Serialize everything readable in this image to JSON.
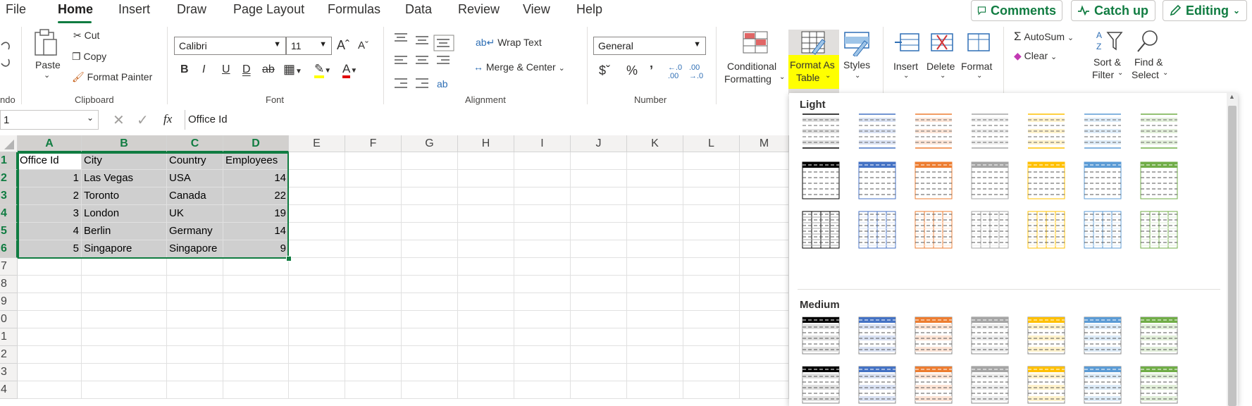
{
  "tabs": {
    "file": "File",
    "home": "Home",
    "insert": "Insert",
    "draw": "Draw",
    "page_layout": "Page Layout",
    "formulas": "Formulas",
    "data": "Data",
    "review": "Review",
    "view": "View",
    "help": "Help"
  },
  "top_buttons": {
    "comments": "Comments",
    "catch_up": "Catch up",
    "editing": "Editing"
  },
  "ribbon": {
    "undo_group_label": "ndo",
    "clipboard": {
      "paste": "Paste",
      "cut": "Cut",
      "copy": "Copy",
      "format_painter": "Format Painter",
      "label": "Clipboard"
    },
    "font": {
      "font_name": "Calibri",
      "font_size": "11",
      "label": "Font"
    },
    "alignment": {
      "wrap_text": "Wrap Text",
      "merge_center": "Merge & Center",
      "label": "Alignment"
    },
    "number": {
      "format": "General",
      "label": "Number"
    },
    "styles": {
      "conditional_formatting_1": "Conditional",
      "conditional_formatting_2": "Formatting",
      "format_as_table_1": "Format As",
      "format_as_table_2": "Table",
      "styles": "Styles"
    },
    "cells": {
      "insert": "Insert",
      "delete": "Delete",
      "format": "Format"
    },
    "editing": {
      "autosum": "AutoSum",
      "clear": "Clear",
      "sort_filter_1": "Sort &",
      "sort_filter_2": "Filter",
      "find_select_1": "Find &",
      "find_select_2": "Select"
    }
  },
  "formula_bar": {
    "name_box": "1",
    "fx": "fx",
    "content": "Office Id"
  },
  "columns": [
    "A",
    "B",
    "C",
    "D",
    "E",
    "F",
    "G",
    "H",
    "I",
    "J",
    "K",
    "L",
    "M"
  ],
  "rows": [
    "1",
    "2",
    "3",
    "4",
    "5",
    "6",
    "7",
    "8",
    "9",
    "0",
    "1",
    "2",
    "3",
    "4"
  ],
  "sheet": {
    "headers": [
      "Office Id",
      "City",
      "Country",
      "Employees"
    ],
    "data": [
      [
        "1",
        "Las Vegas",
        "USA",
        "14"
      ],
      [
        "2",
        "Toronto",
        "Canada",
        "22"
      ],
      [
        "3",
        "London",
        "UK",
        "19"
      ],
      [
        "4",
        "Berlin",
        "Germany",
        "14"
      ],
      [
        "5",
        "Singapore",
        "Singapore",
        "9"
      ]
    ]
  },
  "gallery": {
    "light_label": "Light",
    "medium_label": "Medium",
    "colors": [
      "#000000",
      "#4472c4",
      "#ed7d31",
      "#a5a5a5",
      "#ffc000",
      "#5b9bd5",
      "#70ad47"
    ],
    "tints": [
      "#e0e0e0",
      "#d9e1f2",
      "#fce4d6",
      "#ededed",
      "#fff2cc",
      "#ddebf7",
      "#e2efda"
    ]
  },
  "colors": {
    "accent_green": "#107c41",
    "highlight": "#ffff00"
  }
}
